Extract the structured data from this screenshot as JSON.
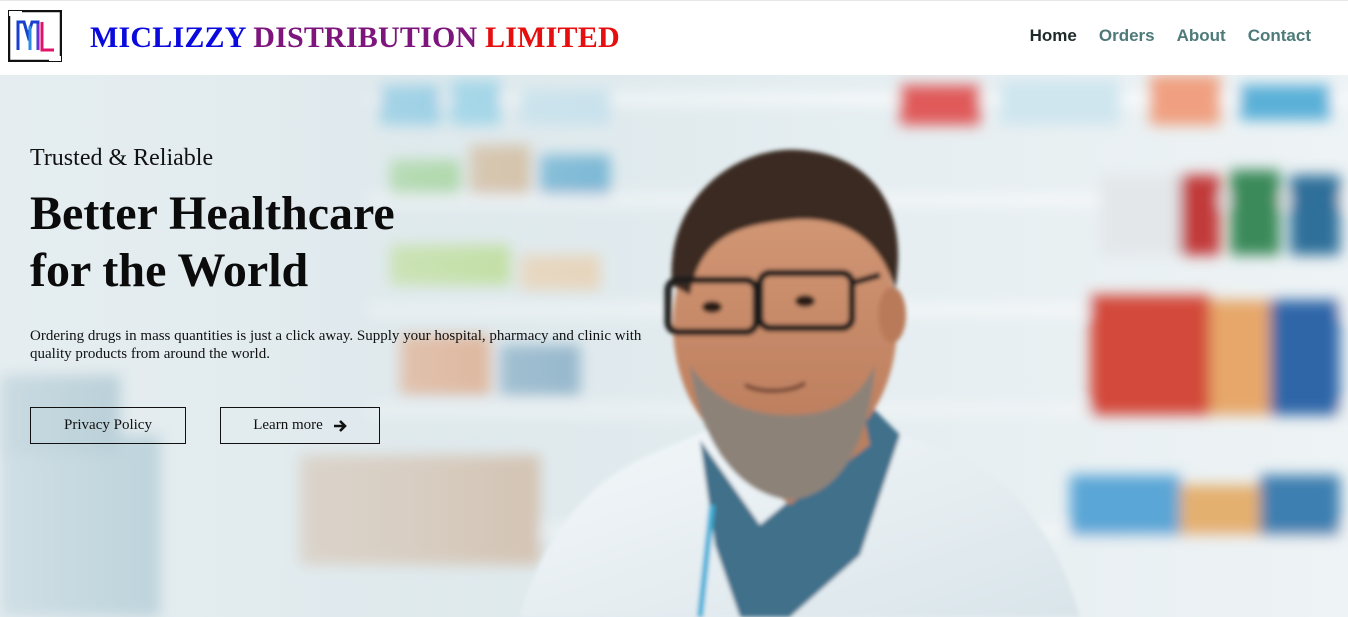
{
  "brand": {
    "part1": "MICLIZZY",
    "part2": "DISTRIBUTION",
    "part3": "LIMITED",
    "logo_icon": "ml-monogram-logo",
    "colors": {
      "part1": "#0a0adf",
      "part2": "#7d157d",
      "part3": "#e60e0e"
    }
  },
  "nav": {
    "items": [
      {
        "label": "Home",
        "active": true
      },
      {
        "label": "Orders",
        "active": false
      },
      {
        "label": "About",
        "active": false
      },
      {
        "label": "Contact",
        "active": false
      }
    ]
  },
  "hero": {
    "tagline": "Trusted & Reliable",
    "headline_line1": "Better Healthcare",
    "headline_line2": "for the World",
    "description": "Ordering drugs in mass quantities is just a click away. Supply your hospital, pharmacy and clinic with quality products from around the world.",
    "buttons": {
      "privacy_label": "Privacy Policy",
      "learn_label": "Learn more",
      "learn_icon": "arrow-right-icon"
    },
    "image": "pharmacist-in-pharmacy-photo"
  }
}
